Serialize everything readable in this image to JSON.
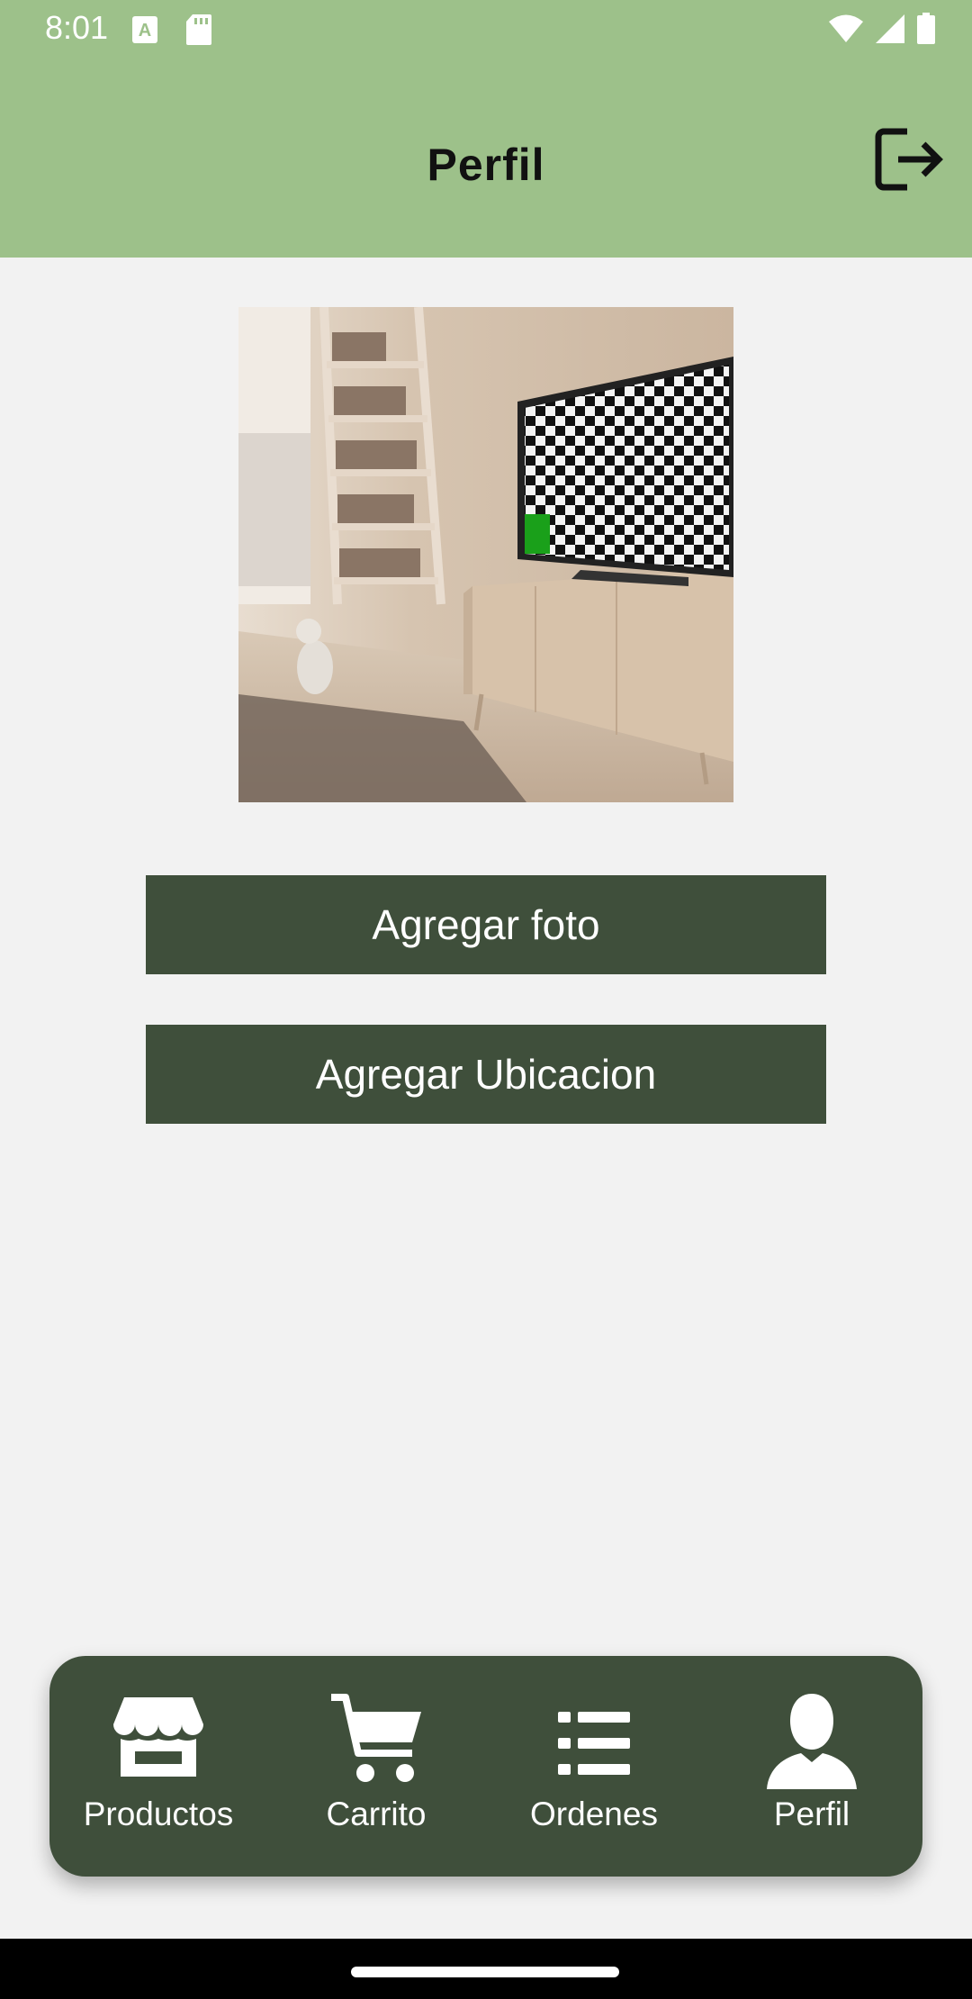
{
  "status_bar": {
    "time": "8:01",
    "icons": [
      "keyboard-a-icon",
      "sd-card-icon",
      "wifi-icon",
      "signal-icon",
      "battery-icon"
    ]
  },
  "header": {
    "title": "Perfil",
    "action_icon": "logout-icon"
  },
  "profile": {
    "photo_description_icon": "profile-photo",
    "buttons": {
      "add_photo": "Agregar foto",
      "add_location": "Agregar Ubicacion"
    }
  },
  "bottom_nav": {
    "items": [
      {
        "label": "Productos",
        "icon": "store-icon"
      },
      {
        "label": "Carrito",
        "icon": "cart-icon"
      },
      {
        "label": "Ordenes",
        "icon": "list-icon"
      },
      {
        "label": "Perfil",
        "icon": "person-icon",
        "active": true
      }
    ]
  },
  "colors": {
    "header_bg": "#9dc18a",
    "button_bg": "#3f4f3b",
    "page_bg": "#f2f2f2",
    "nav_bg": "#3f4f3b"
  }
}
